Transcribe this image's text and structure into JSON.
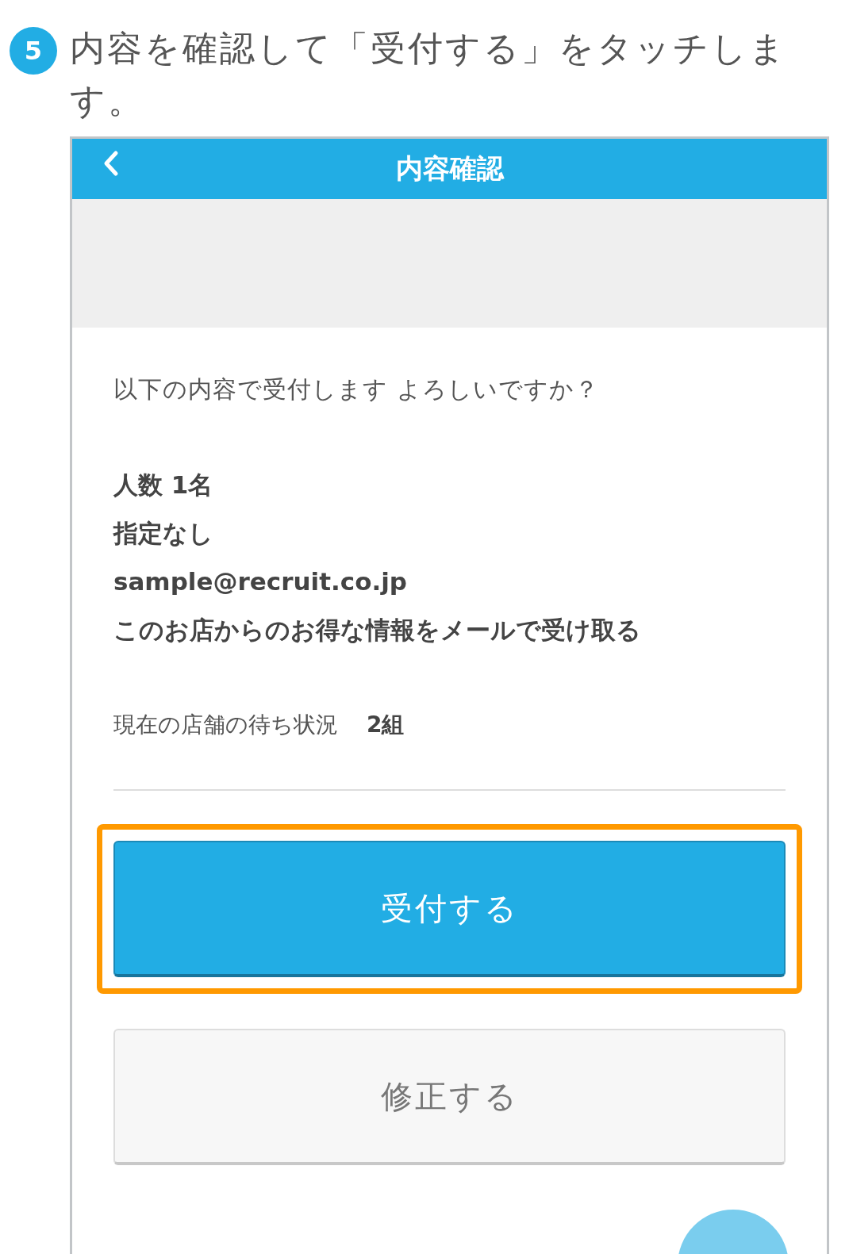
{
  "step": {
    "number": "5",
    "text": "内容を確認して「受付する」をタッチします。"
  },
  "phone": {
    "header": {
      "title": "内容確認"
    },
    "message": "以下の内容で受付します よろしいですか？",
    "details": [
      "人数 1名",
      "指定なし",
      "sample@recruit.co.jp",
      "このお店からのお得な情報をメールで受け取る"
    ],
    "wait_status": {
      "label": "現在の店舗の待ち状況",
      "value": "2組"
    },
    "buttons": [
      {
        "label": "受付する",
        "kind": "primary",
        "highlighted": true
      },
      {
        "label": "修正する",
        "kind": "secondary",
        "highlighted": false
      }
    ]
  }
}
